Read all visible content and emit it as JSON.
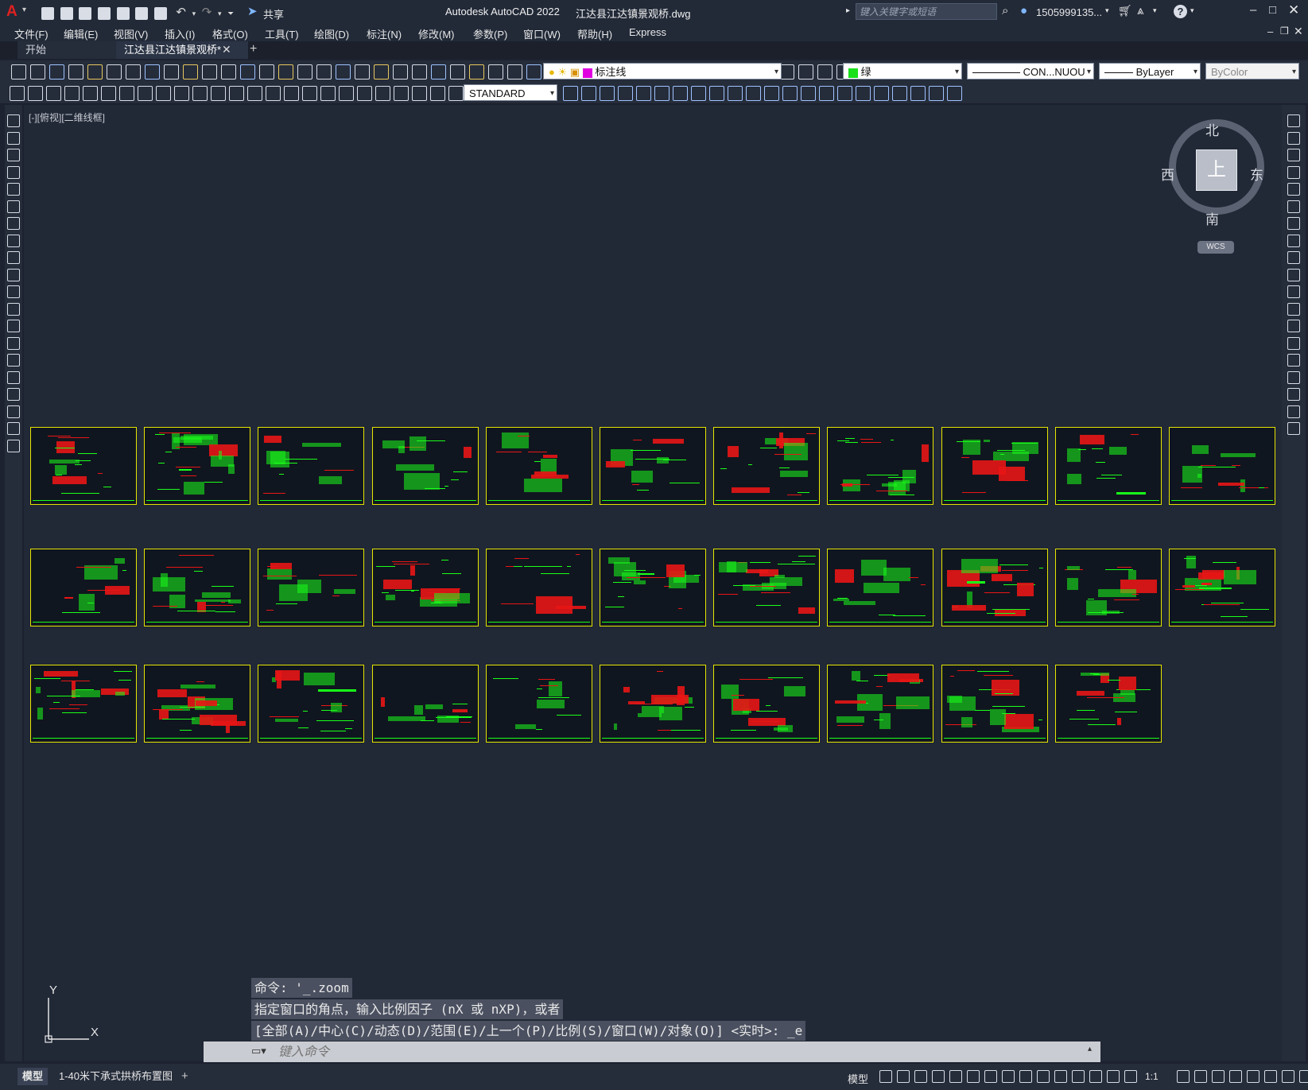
{
  "titlebar": {
    "app_name": "Autodesk AutoCAD 2022",
    "document": "江达县江达镇景观桥.dwg",
    "share_label": "共享",
    "search_placeholder": "键入关键字或短语",
    "user": "1505999135..."
  },
  "menu": [
    "文件(F)",
    "编辑(E)",
    "视图(V)",
    "插入(I)",
    "格式(O)",
    "工具(T)",
    "绘图(D)",
    "标注(N)",
    "修改(M)",
    "参数(P)",
    "窗口(W)",
    "帮助(H)",
    "Express"
  ],
  "tabs": {
    "start": "开始",
    "document": "江达县江达镇景观桥*"
  },
  "toolbar": {
    "layer": "标注线",
    "color": "绿",
    "linetype": "CON...NUOU",
    "lineweight": "ByLayer",
    "plotstyle": "ByColor",
    "textstyle": "STANDARD"
  },
  "viewport": {
    "label": "[-][俯视][二维线框]"
  },
  "viewcube": {
    "north": "北",
    "south": "南",
    "east": "东",
    "west": "西",
    "face": "上",
    "wcs": "WCS"
  },
  "ucs": {
    "x": "X",
    "y": "Y"
  },
  "command": {
    "history": [
      "命令: '_.zoom",
      "指定窗口的角点，输入比例因子 (nX 或 nXP)，或者",
      "[全部(A)/中心(C)/动态(D)/范围(E)/上一个(P)/比例(S)/窗口(W)/对象(O)] <实时>: _e"
    ],
    "placeholder": "键入命令"
  },
  "layout_tabs": {
    "model": "模型",
    "layout1": "1-40米下承式拱桥布置图"
  },
  "status": {
    "model": "模型",
    "scale": "1:1"
  },
  "colors": {
    "sheet_border": "#e5e500",
    "drawing_green": "#19ff19",
    "drawing_red": "#e81515",
    "canvas": "#212836"
  }
}
